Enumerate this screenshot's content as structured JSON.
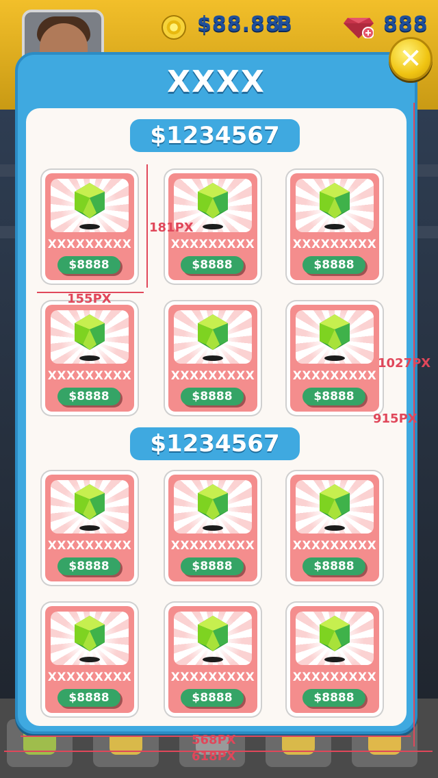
{
  "topbar": {
    "coins": "$88.88",
    "coins_suffix": "B",
    "gems": "888",
    "coin_icon": "coin-icon",
    "gem_icon": "gem-plus-icon"
  },
  "modal": {
    "title": "XXXX",
    "close_icon": "close-icon",
    "sections": [
      {
        "header": "$1234567",
        "items": [
          {
            "label": "XXXXXXXXX",
            "price": "$8888"
          },
          {
            "label": "XXXXXXXXX",
            "price": "$8888"
          },
          {
            "label": "XXXXXXXXX",
            "price": "$8888"
          },
          {
            "label": "XXXXXXXXX",
            "price": "$8888"
          },
          {
            "label": "XXXXXXXXX",
            "price": "$8888"
          },
          {
            "label": "XXXXXXXXX",
            "price": "$8888"
          }
        ]
      },
      {
        "header": "$1234567",
        "items": [
          {
            "label": "XXXXXXXXX",
            "price": "$8888"
          },
          {
            "label": "XXXXXXXXX",
            "price": "$8888"
          },
          {
            "label": "XXXXXXXXX",
            "price": "$8888"
          },
          {
            "label": "XXXXXXXXX",
            "price": "$8888"
          },
          {
            "label": "XXXXXXXXX",
            "price": "$8888"
          },
          {
            "label": "XXXXXXXXX",
            "price": "$8888"
          }
        ]
      }
    ]
  },
  "annotations": {
    "card_height": "181PX",
    "card_width": "155PX",
    "modal_height": "1027PX",
    "panel_height": "915PX",
    "panel_width": "568PX",
    "modal_width": "618PX"
  },
  "bottom_nav": {
    "icons": [
      "arrow-icon",
      "trophy-icon",
      "home-icon",
      "sheriff-star-icon",
      "more-icon"
    ]
  },
  "colors": {
    "modal": "#3fa9e0",
    "card": "#f48d8d",
    "price_button": "#35a466",
    "gem": "#7ed321",
    "annotation": "#e0475a"
  }
}
